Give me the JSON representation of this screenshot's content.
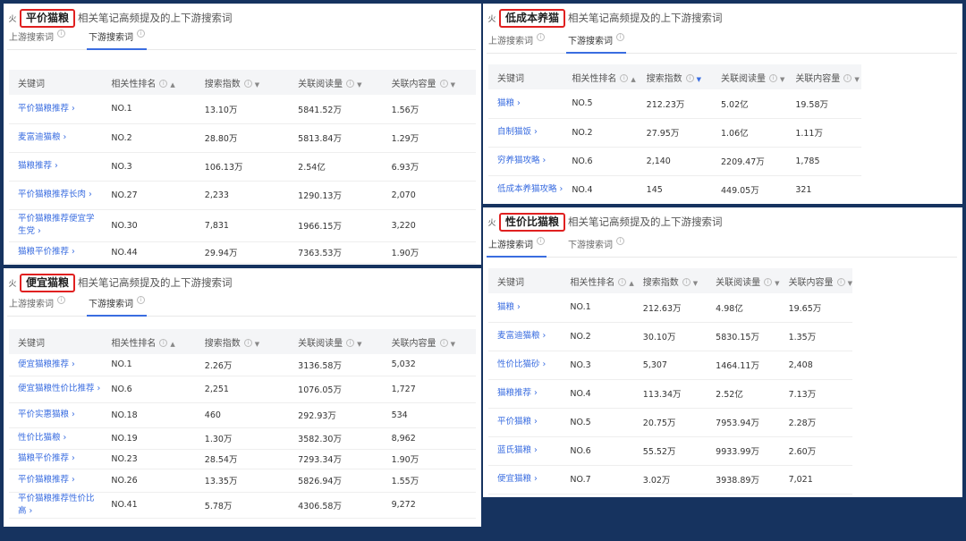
{
  "columns": [
    "关键词",
    "相关性排名",
    "搜索指数",
    "关联阅读量",
    "关联内容量"
  ],
  "columns_alt": [
    "关键词",
    "相关性排名",
    "搜索指数",
    "关联阅读量",
    "关联内容量"
  ],
  "subtitle": "相关笔记高频提及的上下游搜索词",
  "tab_up": "上游搜索词",
  "tab_down": "下游搜索词",
  "icons": {
    "fire": "fire-icon",
    "info": "info-icon",
    "sort": "sort-arrow-icon"
  },
  "colors": {
    "link": "#3a6de0",
    "highlight_border": "#e02020",
    "background": "#16335f"
  },
  "panels": [
    {
      "tag": "平价猫粮",
      "active_tab": "down",
      "rows": [
        [
          "平价猫粮推荐 ›",
          "NO.1",
          "13.10万",
          "5841.52万",
          "1.56万"
        ],
        [
          "麦富迪猫粮 ›",
          "NO.2",
          "28.80万",
          "5813.84万",
          "1.29万"
        ],
        [
          "猫粮推荐 ›",
          "NO.3",
          "106.13万",
          "2.54亿",
          "6.93万"
        ],
        [
          "平价猫粮推荐长肉 ›",
          "NO.27",
          "2,233",
          "1290.13万",
          "2,070"
        ],
        [
          "平价猫粮推荐便宜学生党 ›",
          "NO.30",
          "7,831",
          "1966.15万",
          "3,220"
        ],
        [
          "猫粮平价推荐 ›",
          "NO.44",
          "29.94万",
          "7363.53万",
          "1.90万"
        ]
      ]
    },
    {
      "tag": "便宜猫粮",
      "active_tab": "down",
      "rows": [
        [
          "便宜猫粮推荐 ›",
          "NO.1",
          "2.26万",
          "3136.58万",
          "5,032"
        ],
        [
          "便宜猫粮性价比推荐 ›",
          "NO.6",
          "2,251",
          "1076.05万",
          "1,727"
        ],
        [
          "平价实惠猫粮 ›",
          "NO.18",
          "460",
          "292.93万",
          "534"
        ],
        [
          "性价比猫粮 ›",
          "NO.19",
          "1.30万",
          "3582.30万",
          "8,962"
        ],
        [
          "猫粮平价推荐 ›",
          "NO.23",
          "28.54万",
          "7293.34万",
          "1.90万"
        ],
        [
          "平价猫粮推荐 ›",
          "NO.26",
          "13.35万",
          "5826.94万",
          "1.55万"
        ],
        [
          "平价猫粮推荐性价比高 ›",
          "NO.41",
          "5.78万",
          "4306.58万",
          "9,272"
        ]
      ]
    },
    {
      "tag": "低成本养猫",
      "active_tab": "down",
      "rows": [
        [
          "猫粮 ›",
          "NO.5",
          "212.23万",
          "5.02亿",
          "19.58万"
        ],
        [
          "自制猫饭 ›",
          "NO.2",
          "27.95万",
          "1.06亿",
          "1.11万"
        ],
        [
          "穷养猫攻略 ›",
          "NO.6",
          "2,140",
          "2209.47万",
          "1,785"
        ],
        [
          "低成本养猫攻略 ›",
          "NO.4",
          "145",
          "449.05万",
          "321"
        ]
      ]
    },
    {
      "tag": "性价比猫粮",
      "active_tab": "up",
      "rows": [
        [
          "猫粮 ›",
          "NO.1",
          "212.63万",
          "4.98亿",
          "19.65万"
        ],
        [
          "麦富迪猫粮 ›",
          "NO.2",
          "30.10万",
          "5830.15万",
          "1.35万"
        ],
        [
          "性价比猫砂 ›",
          "NO.3",
          "5,307",
          "1464.11万",
          "2,408"
        ],
        [
          "猫粮推荐 ›",
          "NO.4",
          "113.34万",
          "2.52亿",
          "7.13万"
        ],
        [
          "平价猫粮 ›",
          "NO.5",
          "20.75万",
          "7953.94万",
          "2.28万"
        ],
        [
          "蓝氏猫粮 ›",
          "NO.6",
          "55.52万",
          "9933.99万",
          "2.60万"
        ],
        [
          "便宜猫粮 ›",
          "NO.7",
          "3.02万",
          "3938.89万",
          "7,021"
        ]
      ]
    }
  ]
}
